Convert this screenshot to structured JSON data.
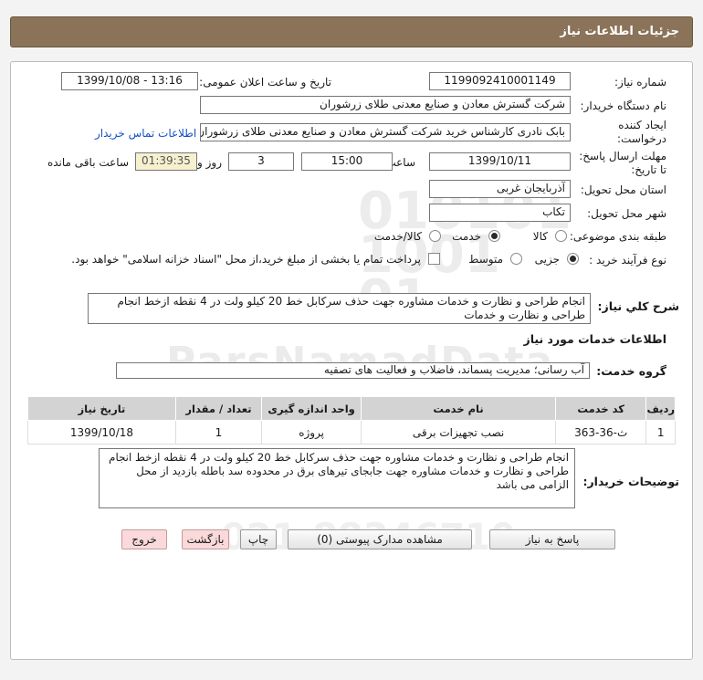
{
  "header": {
    "title": "جزئیات اطلاعات نیاز"
  },
  "watermark": {
    "site": "ParsNamadData",
    "phone": "021-88346710"
  },
  "fields": {
    "need_number_label": "شماره نیاز:",
    "need_number": "1199092410001149",
    "announce_label": "تاریخ و ساعت اعلان عمومی:",
    "announce_value": "1399/10/08 - 13:16",
    "buyer_label": "نام دستگاه خریدار:",
    "buyer_value": "شرکت گسترش معادن و صنایع معدنی طلای زرشوران",
    "creator_label_1": "ایجاد کننده",
    "creator_label_2": "درخواست:",
    "creator_value": "بابک نادری کارشناس خرید شرکت گسترش معادن و صنایع معدنی طلای زرشوران",
    "contact_link": "اطلاعات تماس خریدار",
    "deadline_label_1": "مهلت ارسال پاسخ:",
    "deadline_label_2": "تا تاریخ:",
    "deadline_date": "1399/10/11",
    "time_label": "ساعت",
    "deadline_time": "15:00",
    "days_value": "3",
    "days_label": "روز و",
    "remaining_time": "01:39:35",
    "remaining_label": "ساعت باقی مانده",
    "province_label": "استان محل تحویل:",
    "province_value": "آذربایجان غربی",
    "city_label": "شهر محل تحویل:",
    "city_value": "تکاب",
    "category_label": "طبقه بندی موضوعی:",
    "category_options": [
      "کالا",
      "خدمت",
      "کالا/خدمت"
    ],
    "category_selected": 1,
    "process_label": "نوع فرآیند خرید :",
    "process_options": [
      "جزیی",
      "متوسط"
    ],
    "process_selected": 0,
    "payment_note": "پرداخت تمام یا بخشی از مبلغ خرید،از محل \"اسناد خزانه اسلامی\" خواهد بود."
  },
  "summary": {
    "label": "شرح کلي نياز:",
    "value": "انجام طراحی و نظارت و خدمات مشاوره جهت حذف سرکابل خط 20 کیلو ولت در 4 نقطه ازخط انجام طراحی و نظارت و خدمات"
  },
  "services": {
    "section_title": "اطلاعات خدمات مورد نیاز",
    "group_label": "گروه خدمت:",
    "group_value": "آب رسانی؛ مدیریت پسماند، فاضلاب و فعالیت های تصفیه",
    "columns": [
      "ردیف",
      "کد خدمت",
      "نام خدمت",
      "واحد اندازه گیری",
      "تعداد / مقدار",
      "تاریخ نیاز"
    ],
    "rows": [
      {
        "row": "1",
        "code": "ث-36-363",
        "name": "نصب تجهیزات برقی",
        "unit": "پروژه",
        "qty": "1",
        "date": "1399/10/18"
      }
    ]
  },
  "buyer_desc": {
    "label": "توضیحات خریدار:",
    "value": "انجام طراحی و نظارت و خدمات مشاوره جهت حذف سرکابل خط 20 کیلو ولت در 4 نقطه ازخط انجام طراحی و نظارت و خدمات مشاوره جهت  جابجای تیرهای برق در محدوده سد باطله بازدید از محل الزامی می باشد"
  },
  "buttons": {
    "reply": "پاسخ به نیاز",
    "attachments": "مشاهده مدارک پیوستی (0)",
    "print": "چاپ",
    "back": "بازگشت",
    "exit": "خروج"
  }
}
